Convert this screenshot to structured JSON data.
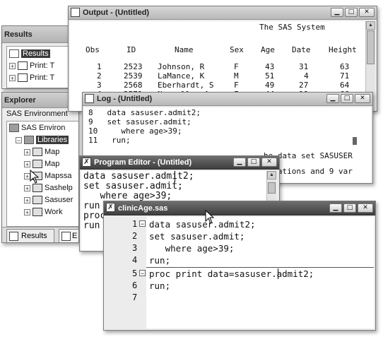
{
  "results_win": {
    "title": "Results",
    "items": [
      {
        "label": "Results"
      },
      {
        "label": "Print:  T"
      },
      {
        "label": "Print:  T"
      }
    ]
  },
  "explorer_win": {
    "title": "Explorer",
    "location": "SAS Environment",
    "tree": [
      {
        "label": "SAS Environ"
      },
      {
        "label": "Libraries"
      },
      {
        "label": "Map"
      },
      {
        "label": "Map"
      },
      {
        "label": "Mapssa"
      },
      {
        "label": "Sashelp"
      },
      {
        "label": "Sasuser"
      },
      {
        "label": "Work"
      }
    ],
    "tabs": {
      "results": "Results",
      "explorer": "E"
    }
  },
  "output_win": {
    "title": "Output - (Untitled)",
    "heading": "The SAS System",
    "columns": [
      "Obs",
      "ID",
      "Name",
      "Sex",
      "Age",
      "Date",
      "Height"
    ],
    "rows": [
      [
        "1",
        "2523",
        "Johnson, R",
        "F",
        "43",
        "31",
        "63"
      ],
      [
        "2",
        "2539",
        "LaMance, K",
        "M",
        "51",
        "4",
        "71"
      ],
      [
        "3",
        "2568",
        "Eberhardt, S",
        "F",
        "49",
        "27",
        "64"
      ],
      [
        "4",
        "2571",
        "Nunnelly, A",
        "F",
        "44",
        "19",
        "66"
      ]
    ]
  },
  "log_win": {
    "title": "Log - (Untitled)",
    "lines": [
      {
        "num": "8",
        "code": "   data sasuser.admit2;"
      },
      {
        "num": "9",
        "code": "   set sasuser.admit;"
      },
      {
        "num": "10",
        "code": "     where age>39;"
      },
      {
        "num": "11",
        "code": "   run;"
      }
    ],
    "message_lines": [
      "he data set SASUSER",
      "ervations and 9 var",
      "):"
    ]
  },
  "program_editor_win": {
    "title": "Program Editor - (Untitled)",
    "lines": [
      "data sasuser.admit2;",
      "set sasuser.admit;",
      "   where age>39;",
      "run",
      "proc",
      "run"
    ]
  },
  "clinic_win": {
    "title": "clinicAge.sas",
    "lines": [
      {
        "num": "1",
        "marker": "−",
        "code": "data sasuser.admit2;"
      },
      {
        "num": "2",
        "marker": "",
        "code": "set sasuser.admit;"
      },
      {
        "num": "3",
        "marker": "",
        "code": "   where age>39;"
      },
      {
        "num": "4",
        "marker": "",
        "code": "run;"
      },
      {
        "num": "5",
        "marker": "−",
        "code": "proc print data=sasuser.admit2;"
      },
      {
        "num": "6",
        "marker": "",
        "code": "run;"
      },
      {
        "num": "7",
        "marker": "",
        "code": ""
      }
    ]
  }
}
